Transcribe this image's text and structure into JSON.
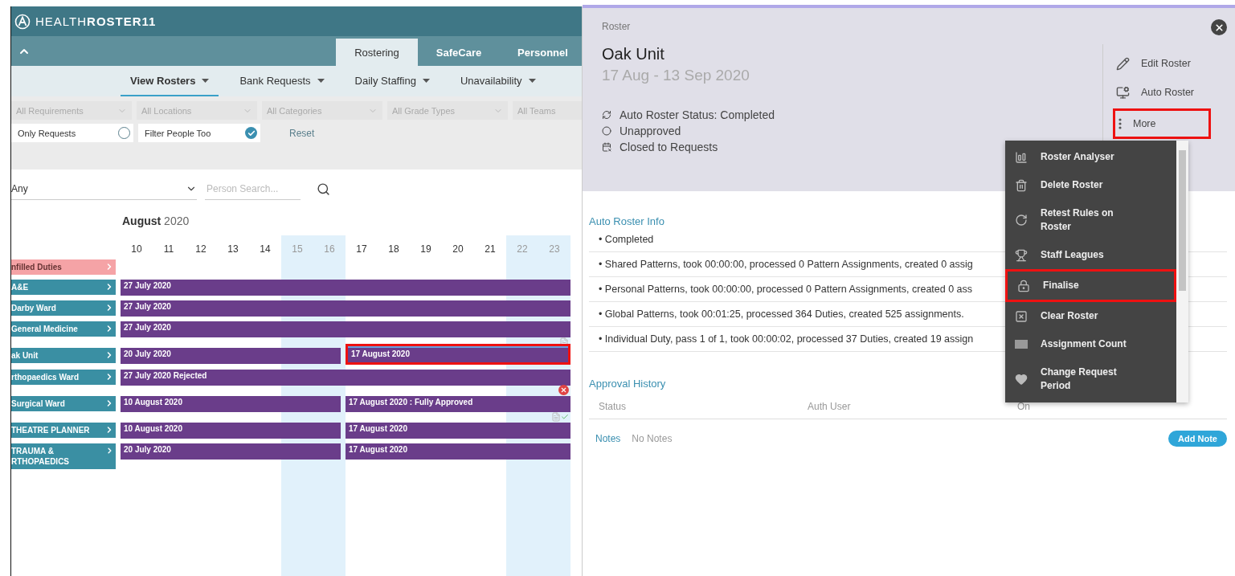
{
  "brand": {
    "prefix": "HEALTH",
    "main": "ROSTER11"
  },
  "main_tabs": [
    {
      "label": "Rostering",
      "selected": true
    },
    {
      "label": "SafeCare",
      "selected": false
    },
    {
      "label": "Personnel",
      "selected": false
    }
  ],
  "sub_nav": [
    {
      "label": "View Rosters",
      "selected": true
    },
    {
      "label": "Bank Requests",
      "selected": false
    },
    {
      "label": "Daily Staffing",
      "selected": false
    },
    {
      "label": "Unavailability",
      "selected": false
    }
  ],
  "filters": [
    {
      "placeholder": "All Requirements"
    },
    {
      "placeholder": "All Locations"
    },
    {
      "placeholder": "All Categories"
    },
    {
      "placeholder": "All Grade Types"
    },
    {
      "placeholder": "All Teams"
    }
  ],
  "toggles": [
    {
      "label": "Only Requests",
      "checked": false
    },
    {
      "label": "Filter People Too",
      "checked": true
    }
  ],
  "reset": "Reset",
  "scope_select": "Any",
  "person_search": {
    "placeholder": "Person Search..."
  },
  "calendar": {
    "month": "August",
    "year": "2020",
    "days": [
      {
        "label": "10",
        "weekend": false
      },
      {
        "label": "11",
        "weekend": false
      },
      {
        "label": "12",
        "weekend": false
      },
      {
        "label": "13",
        "weekend": false
      },
      {
        "label": "14",
        "weekend": false
      },
      {
        "label": "15",
        "weekend": true
      },
      {
        "label": "16",
        "weekend": true
      },
      {
        "label": "17",
        "weekend": false
      },
      {
        "label": "18",
        "weekend": false
      },
      {
        "label": "19",
        "weekend": false
      },
      {
        "label": "20",
        "weekend": false
      },
      {
        "label": "21",
        "weekend": false
      },
      {
        "label": "22",
        "weekend": true
      },
      {
        "label": "23",
        "weekend": true
      }
    ],
    "rows": [
      {
        "label": "nfilled Duties",
        "kind": "unfilled",
        "bars": []
      },
      {
        "label": "A&E",
        "kind": "unit",
        "bars": [
          {
            "text": "27 July 2020",
            "kind": "full",
            "highlighted": false
          }
        ]
      },
      {
        "label": "Darby Ward",
        "kind": "unit",
        "bars": [
          {
            "text": "27 July 2020",
            "kind": "full",
            "highlighted": false
          }
        ]
      },
      {
        "label": "General Medicine",
        "kind": "unit",
        "bars": [
          {
            "text": "27 July 2020",
            "kind": "full",
            "highlighted": false,
            "note": true
          }
        ]
      },
      {
        "label": "ak Unit",
        "kind": "unit",
        "bars": [
          {
            "text": "20 July 2020",
            "kind": "start",
            "highlighted": false
          },
          {
            "text": "17 August 2020",
            "kind": "end",
            "highlighted": true
          }
        ]
      },
      {
        "label": "rthopaedics Ward",
        "kind": "unit",
        "bars": [
          {
            "text": "27 July 2020 Rejected",
            "kind": "full",
            "highlighted": false,
            "rejected": true
          }
        ]
      },
      {
        "label": "Surgical Ward",
        "kind": "unit",
        "bars": [
          {
            "text": "10 August 2020",
            "kind": "start",
            "highlighted": false
          },
          {
            "text": "17 August 2020 : Fully Approved",
            "kind": "end",
            "highlighted": false,
            "note": true,
            "approved": true
          }
        ]
      },
      {
        "label": "THEATRE PLANNER",
        "kind": "unit",
        "bars": [
          {
            "text": "10 August 2020",
            "kind": "start",
            "highlighted": false
          },
          {
            "text": "17 August 2020",
            "kind": "end",
            "highlighted": false
          }
        ]
      },
      {
        "label": "TRAUMA & RTHOPAEDICS",
        "kind": "unit",
        "bars": [
          {
            "text": "20 July 2020",
            "kind": "start",
            "highlighted": false
          },
          {
            "text": "17 August 2020",
            "kind": "end",
            "highlighted": false
          }
        ]
      }
    ]
  },
  "roster_panel": {
    "caption": "Roster",
    "title": "Oak Unit",
    "dates": "17 Aug - 13 Sep 2020",
    "statuses": [
      {
        "kind": "sync",
        "text": "Auto Roster Status: Completed"
      },
      {
        "kind": "unapproved",
        "text": "Unapproved"
      },
      {
        "kind": "closed",
        "text": "Closed to Requests"
      }
    ],
    "actions": [
      {
        "kind": "edit",
        "label": "Edit Roster",
        "highlighted": false
      },
      {
        "kind": "auto",
        "label": "Auto Roster",
        "highlighted": false
      },
      {
        "kind": "more",
        "label": "More",
        "highlighted": true
      }
    ],
    "menu": [
      {
        "kind": "analyser",
        "label": "Roster Analyser",
        "highlighted": false
      },
      {
        "kind": "delete",
        "label": "Delete Roster",
        "highlighted": false
      },
      {
        "kind": "retest",
        "label": "Retest Rules on Roster",
        "highlighted": false
      },
      {
        "kind": "leagues",
        "label": "Staff Leagues",
        "highlighted": false
      },
      {
        "kind": "finalise",
        "label": "Finalise",
        "highlighted": true
      },
      {
        "kind": "clear",
        "label": "Clear Roster",
        "highlighted": false
      },
      {
        "kind": "count",
        "label": "Assignment Count",
        "highlighted": false
      },
      {
        "kind": "period",
        "label": "Change Request Period",
        "highlighted": false
      }
    ],
    "auto_roster_info": {
      "heading": "Auto Roster Info",
      "lines": [
        "• Completed",
        "• Shared Patterns, took 00:00:00, processed 0 Pattern Assignments, created 0 assig",
        "• Personal Patterns, took 00:00:00, processed 0 Pattern Assignments, created 0 ass",
        "• Global Patterns, took 00:01:25, processed 364 Duties, created 525 assignments.",
        "• Individual Duty, pass 1 of 1, took 00:00:02, processed 37 Duties, created 19 assign"
      ]
    },
    "approval_history": {
      "heading": "Approval History",
      "columns": [
        "Status",
        "Auth User",
        "On"
      ]
    },
    "notes": {
      "label": "Notes",
      "value": "No Notes",
      "button": "Add Note"
    }
  }
}
